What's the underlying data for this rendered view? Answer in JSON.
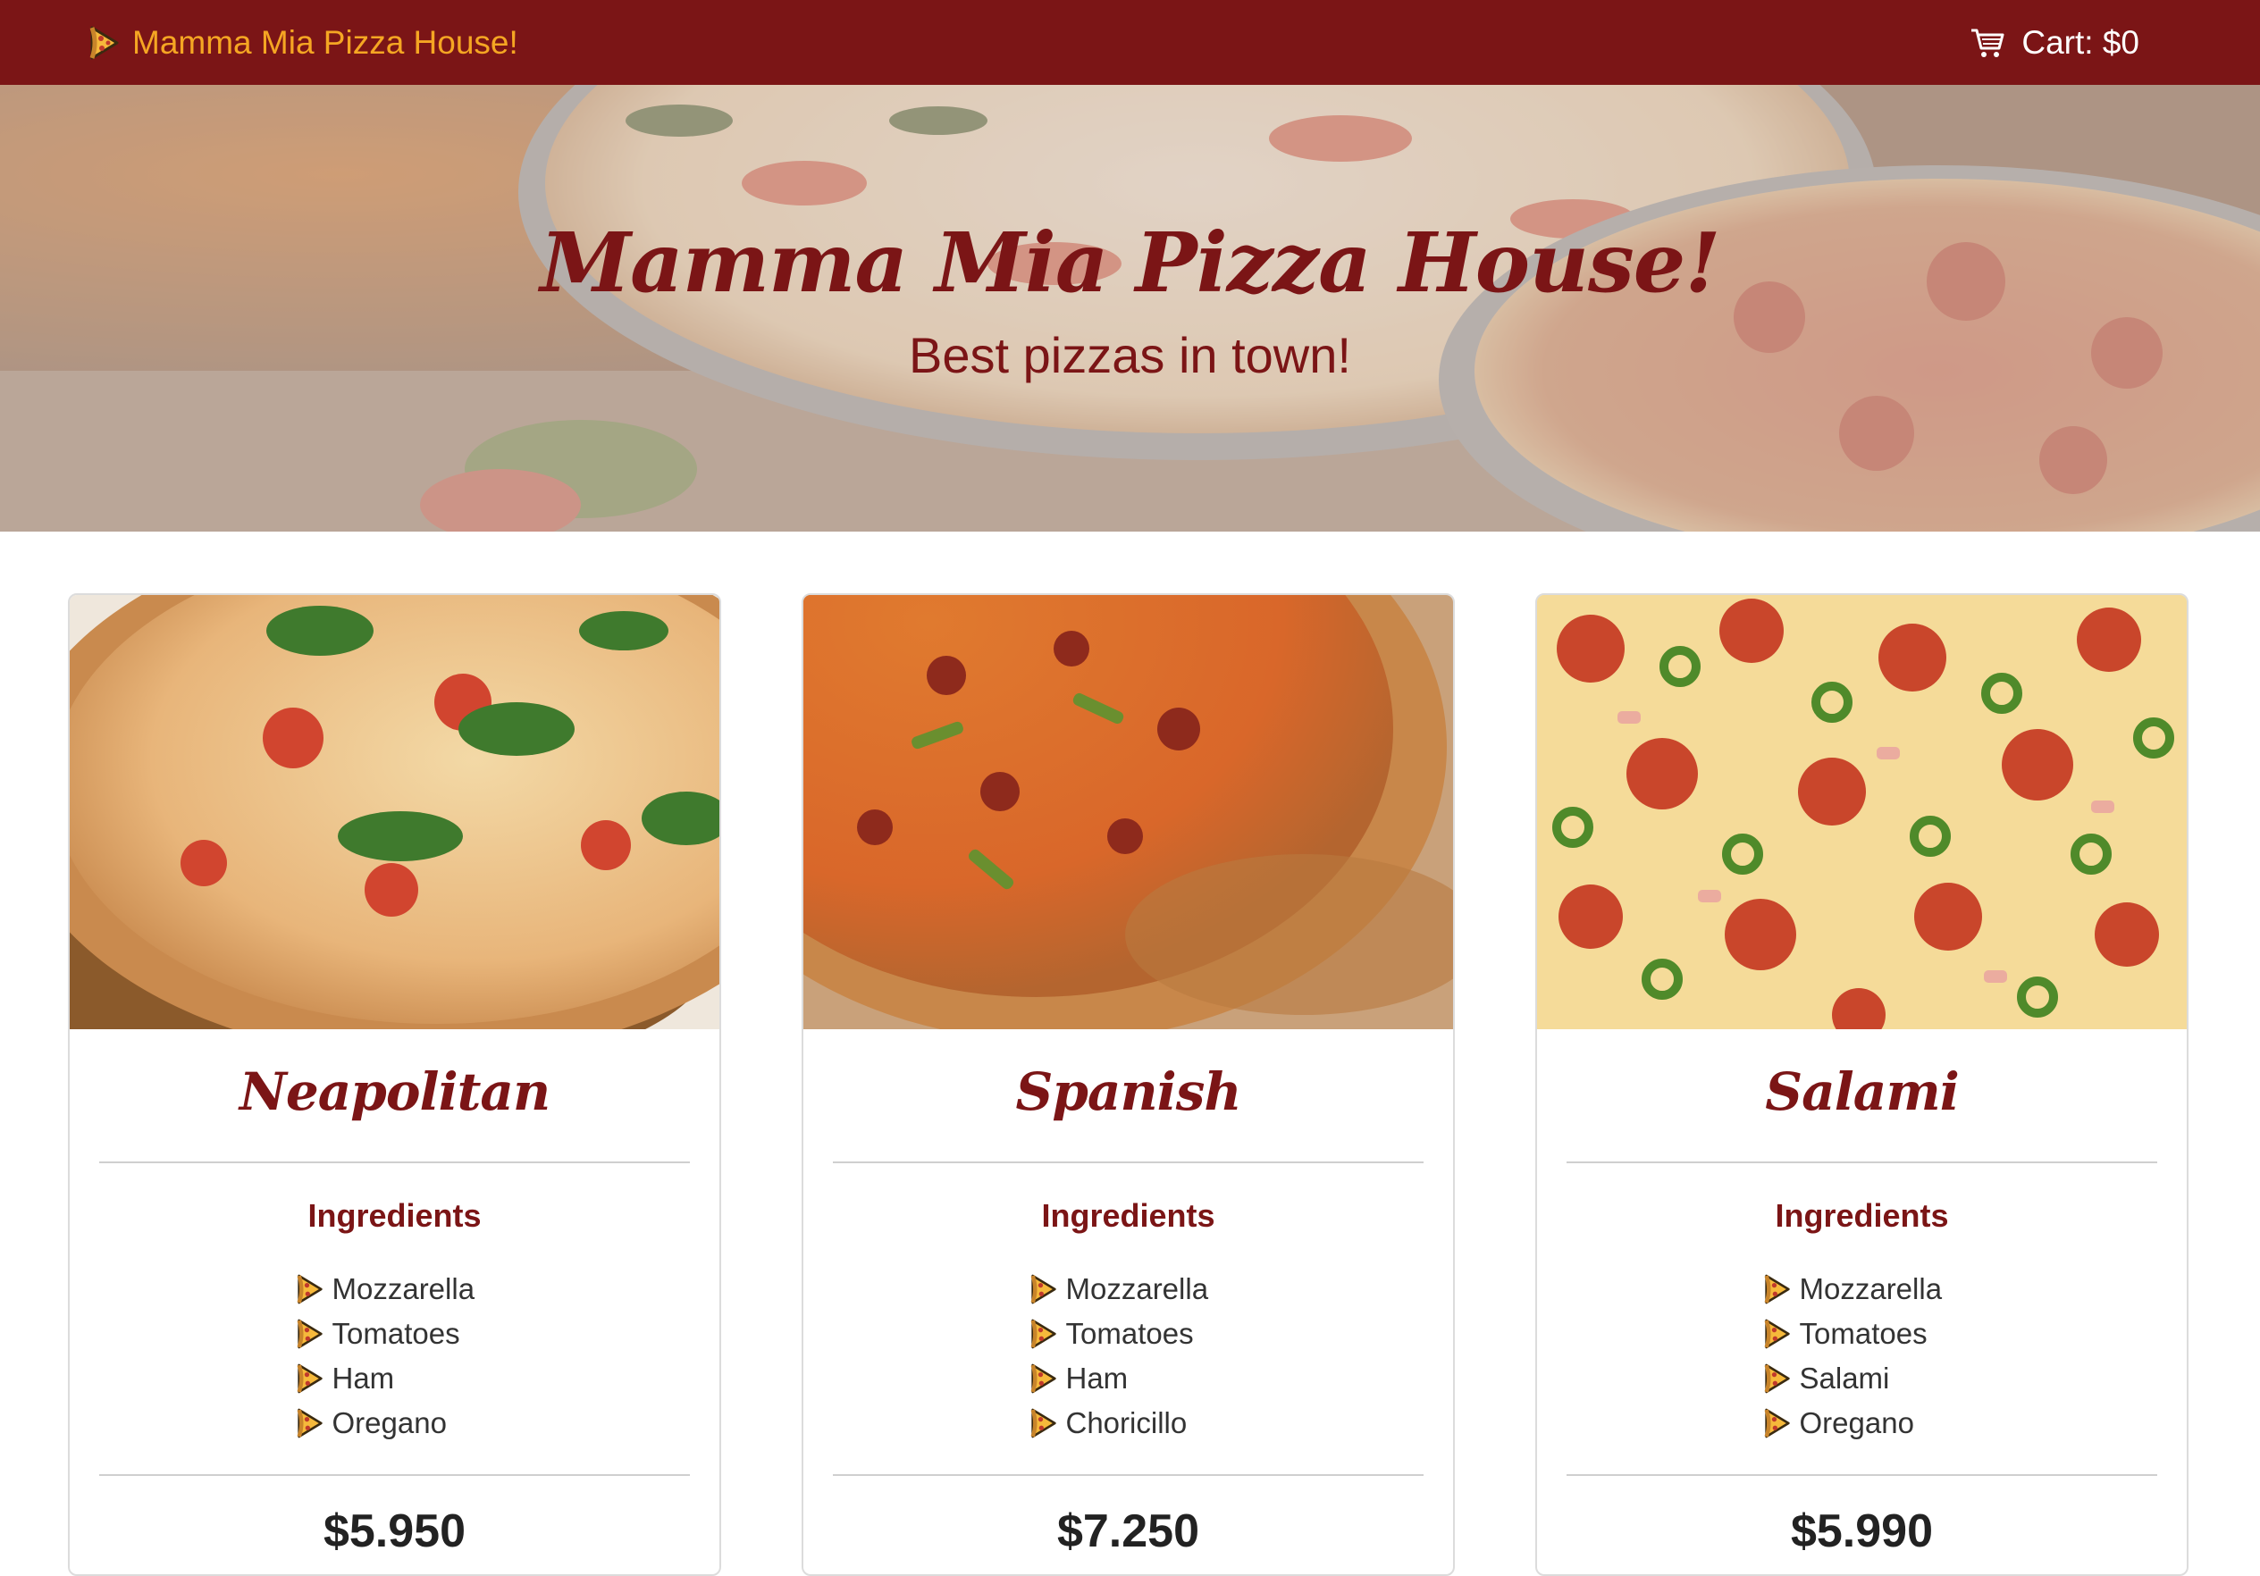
{
  "navbar": {
    "brand_label": "Mamma Mia Pizza House!",
    "brand_icon": "pizza-slice-icon",
    "cart_label": "Cart: $0",
    "cart_icon": "shopping-cart-icon",
    "colors": {
      "background": "#7b1516",
      "brand": "#f5a623",
      "cart": "#ffffff"
    }
  },
  "hero": {
    "title": "Mamma Mia Pizza House!",
    "subtitle": "Best pizzas in town!",
    "text_color": "#7b1516"
  },
  "cards": [
    {
      "name": "Neapolitan",
      "ingredients_title": "Ingredients",
      "ingredients": [
        "Mozzarella",
        "Tomatoes",
        "Ham",
        "Oregano"
      ],
      "price": "$5.950"
    },
    {
      "name": "Spanish",
      "ingredients_title": "Ingredients",
      "ingredients": [
        "Mozzarella",
        "Tomatoes",
        "Ham",
        "Choricillo"
      ],
      "price": "$7.250"
    },
    {
      "name": "Salami",
      "ingredients_title": "Ingredients",
      "ingredients": [
        "Mozzarella",
        "Tomatoes",
        "Salami",
        "Oregano"
      ],
      "price": "$5.990"
    }
  ]
}
